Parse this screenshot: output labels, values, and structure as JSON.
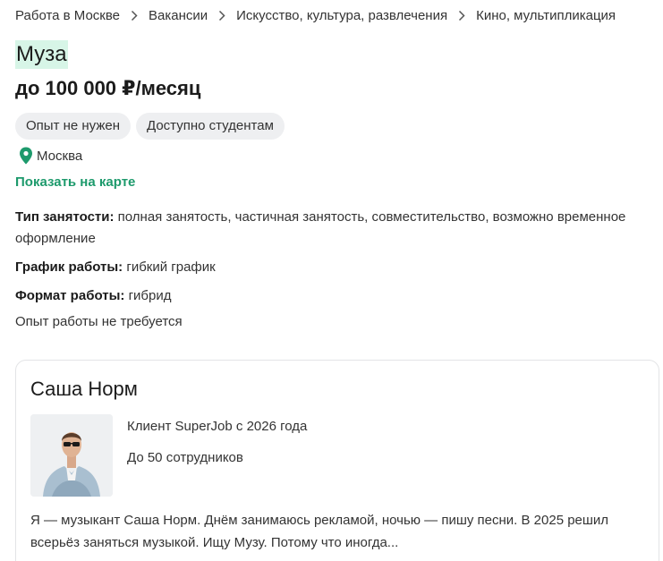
{
  "breadcrumb": {
    "items": [
      "Работа в Москве",
      "Вакансии",
      "Искусство, культура, развлечения",
      "Кино, мультипликация"
    ]
  },
  "vacancy": {
    "title": "Муза",
    "salary": "до 100 000 ₽/месяц",
    "tags": [
      "Опыт не нужен",
      "Доступно студентам"
    ],
    "city": "Москва",
    "map_link": "Показать на карте",
    "details": [
      {
        "label": "Тип занятости:",
        "value": "полная занятость, частичная занятость, совместительство, возможно временное оформление"
      },
      {
        "label": "График работы:",
        "value": "гибкий график"
      },
      {
        "label": "Формат работы:",
        "value": "гибрид"
      }
    ],
    "experience": "Опыт работы не требуется"
  },
  "employer": {
    "name": "Саша Норм",
    "client_since": "Клиент SuperJob с 2026 года",
    "size": "До 50 сотрудников",
    "about": "Я — музыкант Саша Норм. Днём занимаюсь рекламой, ночью — пишу песни. В 2025 решил всерьёз заняться музыкой. Ищу Музу. Потому что иногда..."
  },
  "colors": {
    "accent": "#1d9a6c",
    "title_highlight": "#d7f5e7",
    "tag_bg": "#eeeff1"
  },
  "icons": [
    "chevron-right-icon",
    "location-pin-icon"
  ]
}
